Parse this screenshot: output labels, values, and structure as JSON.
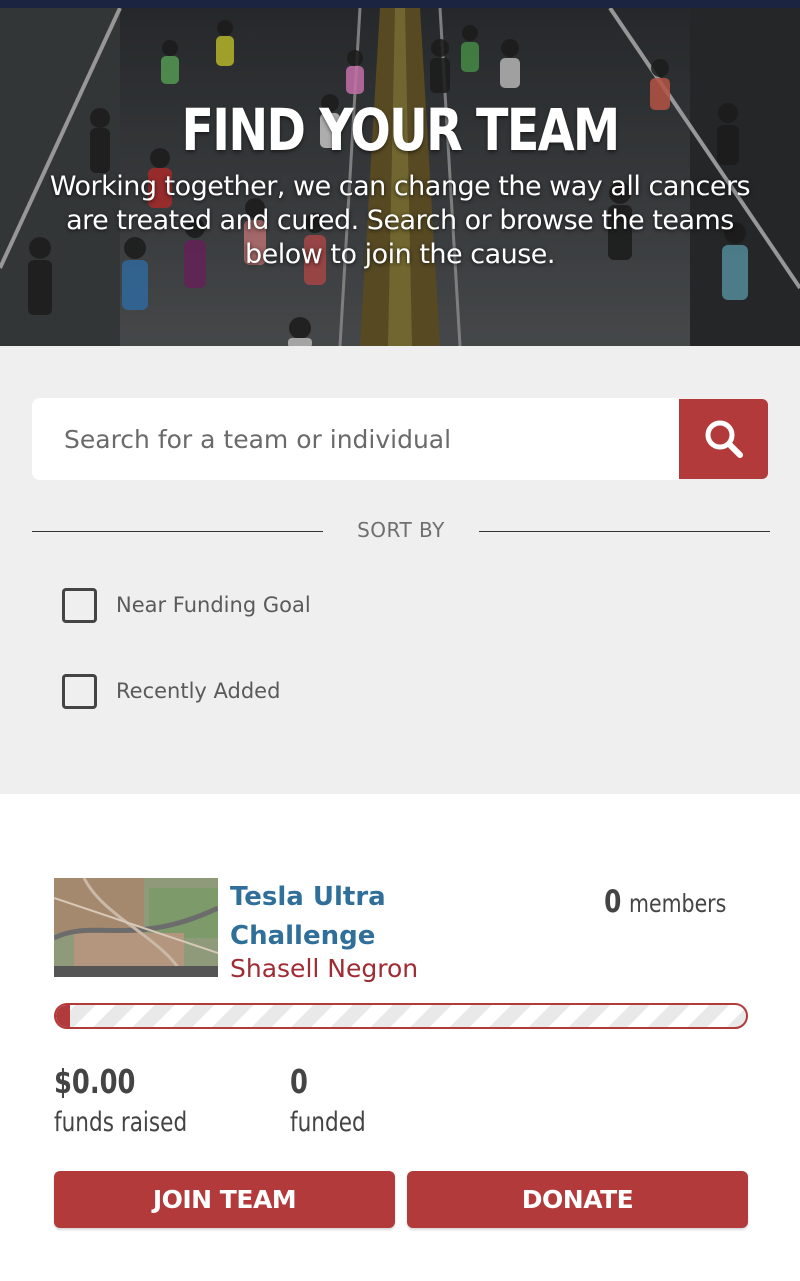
{
  "colors": {
    "accent": "#b33a3a",
    "team_link": "#2f6f9a",
    "captain_link": "#9f2b33",
    "panel_bg": "#efefef",
    "top_bar": "#1b2440"
  },
  "hero": {
    "title": "FIND YOUR TEAM",
    "subtitle": "Working together, we can change the way all cancers are treated and cured. Search or browse the teams below to join the cause."
  },
  "search": {
    "placeholder": "Search for a team or individual",
    "value": "",
    "button_icon": "search-icon"
  },
  "sort": {
    "label": "SORT BY",
    "options": [
      {
        "label": "Near Funding Goal",
        "checked": false
      },
      {
        "label": "Recently Added",
        "checked": false
      }
    ]
  },
  "team": {
    "name": "Tesla Ultra Challenge",
    "captain": "Shasell Negron",
    "members_count": "0",
    "members_label": "members",
    "progress_fraction": 0.02,
    "funds_raised": "$0.00",
    "funds_raised_label": "funds raised",
    "funded": "0",
    "funded_label": "funded",
    "join_label": "JOIN TEAM",
    "donate_label": "DONATE"
  }
}
